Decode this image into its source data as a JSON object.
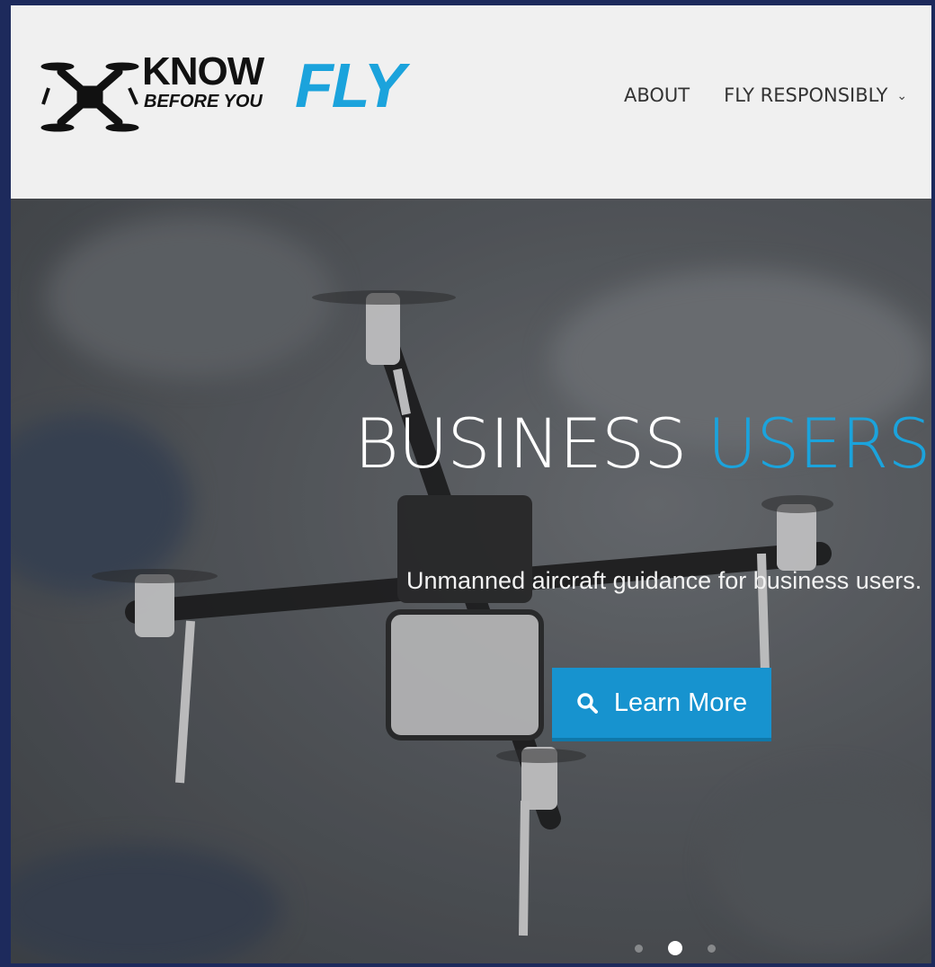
{
  "header": {
    "logo": {
      "know": "KNOW",
      "before_you": "BEFORE YOU",
      "fly": "FLY"
    },
    "nav": {
      "items": [
        {
          "label": "ABOUT"
        },
        {
          "label": "FLY RESPONSIBLY",
          "has_dropdown": true
        }
      ]
    }
  },
  "hero": {
    "title_main": "BUSINESS",
    "title_accent": "USERS",
    "subtitle": "Unmanned aircraft guidance for business users.",
    "button_label": "Learn More",
    "button_icon": "search-icon",
    "slider": {
      "slide_count": 3,
      "active_index": 1
    }
  },
  "colors": {
    "accent": "#1ba3dc",
    "button": "#1793cf",
    "header_bg": "#f0f0f0",
    "frame_border": "#1d2a5c"
  }
}
